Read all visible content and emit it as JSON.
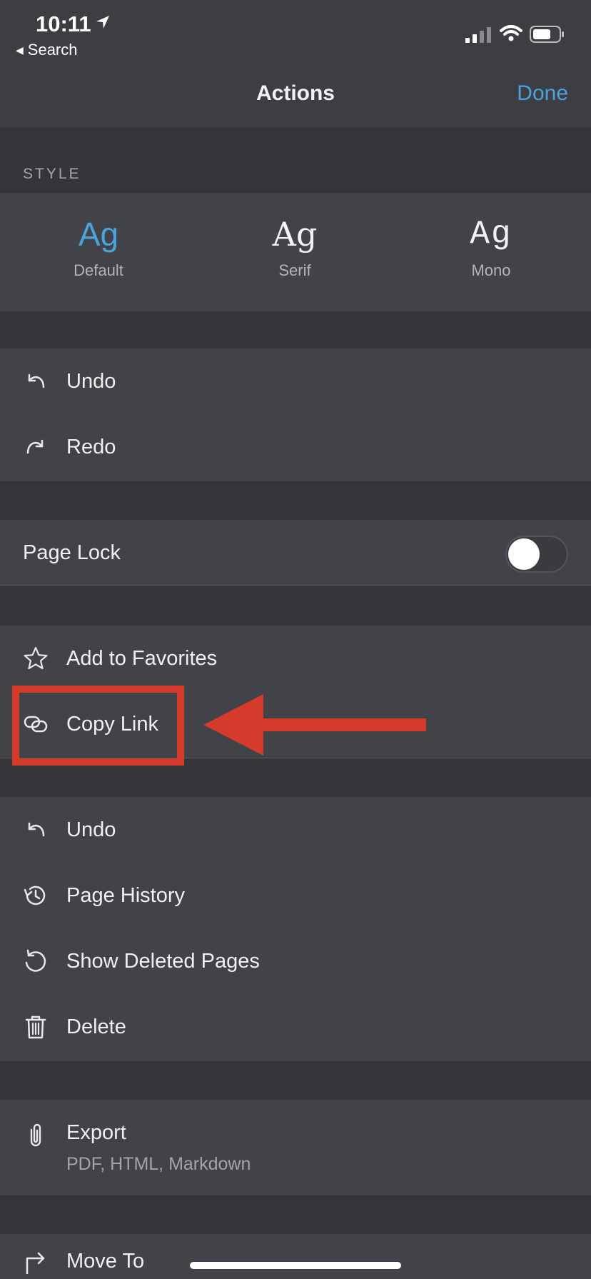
{
  "status_bar": {
    "time": "10:11",
    "back_label": "Search",
    "icons": [
      "location-arrow-icon",
      "cellular-signal-icon",
      "wifi-icon",
      "battery-icon"
    ]
  },
  "nav": {
    "title": "Actions",
    "done_label": "Done"
  },
  "style_section": {
    "label": "STYLE",
    "options": [
      {
        "sample": "Ag",
        "label": "Default",
        "selected": true
      },
      {
        "sample": "Ag",
        "label": "Serif",
        "selected": false
      },
      {
        "sample": "Ag",
        "label": "Mono",
        "selected": false
      }
    ]
  },
  "edit_group": [
    {
      "icon": "undo-icon",
      "label": "Undo"
    },
    {
      "icon": "redo-icon",
      "label": "Redo"
    }
  ],
  "page_lock": {
    "label": "Page Lock",
    "enabled": false
  },
  "share_group": [
    {
      "icon": "star-icon",
      "label": "Add to Favorites"
    },
    {
      "icon": "link-icon",
      "label": "Copy Link"
    }
  ],
  "history_group": [
    {
      "icon": "undo-icon",
      "label": "Undo"
    },
    {
      "icon": "history-icon",
      "label": "Page History"
    },
    {
      "icon": "restore-icon",
      "label": "Show Deleted Pages"
    },
    {
      "icon": "trash-icon",
      "label": "Delete"
    }
  ],
  "export": {
    "icon": "paperclip-icon",
    "label": "Export",
    "subtitle": "PDF, HTML, Markdown"
  },
  "move_to": {
    "icon": "move-arrow-icon",
    "label": "Move To"
  },
  "colors": {
    "accent": "#4aa3d9",
    "annotation": "#d43b2a",
    "background": "#35363b",
    "group_background": "#424348"
  }
}
